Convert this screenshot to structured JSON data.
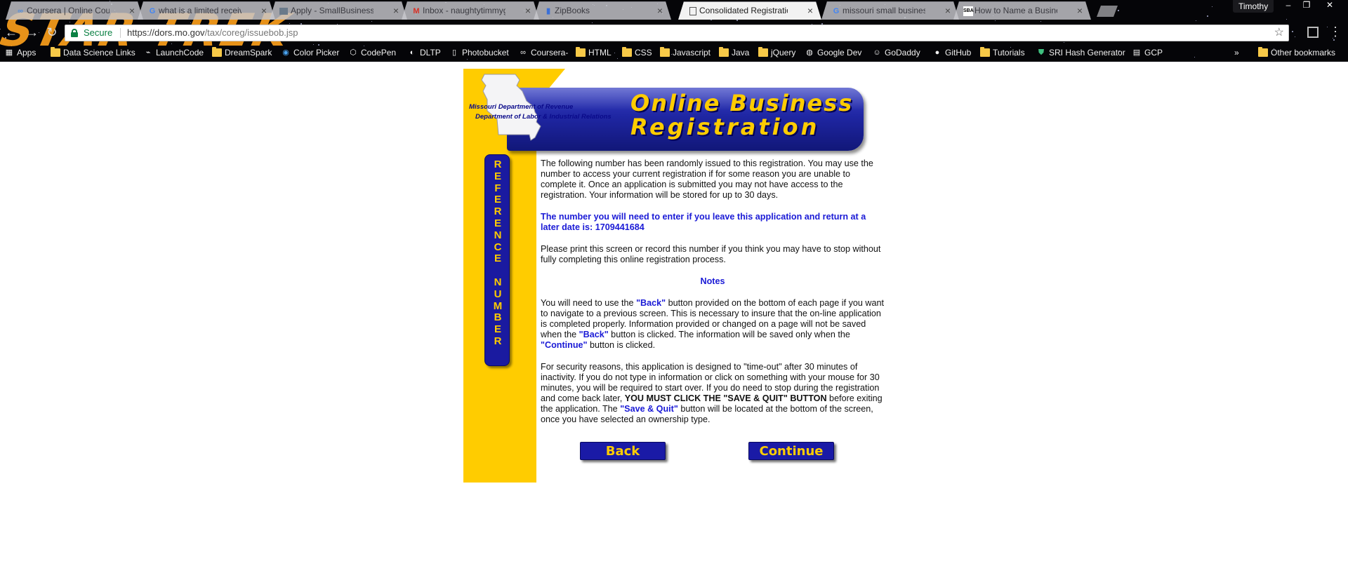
{
  "browser": {
    "tabs": [
      {
        "label": "Coursera | Online Cours",
        "icon": "coursera-icon",
        "active": false
      },
      {
        "label": "what is a limited receive",
        "icon": "google-icon",
        "active": false
      },
      {
        "label": "Apply - SmallBusinessBa",
        "icon": "page-icon",
        "active": false
      },
      {
        "label": "Inbox - naughtytimmyg",
        "icon": "gmail-icon",
        "active": false
      },
      {
        "label": "ZipBooks",
        "icon": "zipbooks-icon",
        "active": false
      },
      {
        "label": "Consolidated Registratio",
        "icon": "document-icon",
        "active": true
      },
      {
        "label": "missouri small business",
        "icon": "google-icon",
        "active": false
      },
      {
        "label": "How to Name a Business",
        "icon": "site-icon",
        "active": false
      }
    ],
    "profile_name": "Timothy",
    "address_bar": {
      "secure_label": "Secure",
      "url_host": "https://dors.mo.gov",
      "url_path": "/tax/coreg/issuebob.jsp"
    },
    "bookmarks": [
      {
        "label": "Apps",
        "icon": "apps-grid-icon"
      },
      {
        "label": "Data Science Links",
        "icon": "folder-icon"
      },
      {
        "label": "LaunchCode",
        "icon": "launchcode-icon"
      },
      {
        "label": "DreamSpark",
        "icon": "folder-icon"
      },
      {
        "label": "Color Picker",
        "icon": "color-picker-icon"
      },
      {
        "label": "CodePen",
        "icon": "codepen-icon"
      },
      {
        "label": "DLTP",
        "icon": "dltp-icon"
      },
      {
        "label": "Photobucket",
        "icon": "page-icon"
      },
      {
        "label": "Coursera-",
        "icon": "coursera-icon"
      },
      {
        "label": "HTML",
        "icon": "folder-icon"
      },
      {
        "label": "CSS",
        "icon": "folder-icon"
      },
      {
        "label": "Javascript",
        "icon": "folder-icon"
      },
      {
        "label": "Java",
        "icon": "folder-icon"
      },
      {
        "label": "jQuery",
        "icon": "folder-icon"
      },
      {
        "label": "Google Dev",
        "icon": "google-dev-icon"
      },
      {
        "label": "GoDaddy",
        "icon": "godaddy-icon"
      },
      {
        "label": "GitHub",
        "icon": "github-icon"
      },
      {
        "label": "Tutorials",
        "icon": "folder-icon"
      },
      {
        "label": "SRI Hash Generator",
        "icon": "shield-icon"
      },
      {
        "label": "GCP",
        "icon": "gcp-icon"
      }
    ],
    "overflow_label": "»",
    "other_bookmarks_label": "Other bookmarks"
  },
  "page": {
    "header": {
      "agency_line1": "Missouri Department of Revenue",
      "agency_line2": "Department of Labor & Industrial Relations",
      "title_line1": "Online Business",
      "title_line2": "Registration"
    },
    "sidebar_badge": {
      "letters": [
        "R",
        "E",
        "F",
        "E",
        "R",
        "E",
        "N",
        "C",
        "E",
        " ",
        "N",
        "U",
        "M",
        "B",
        "E",
        "R"
      ]
    },
    "intro_text": "The following number has been randomly issued to this registration. You may use the number to access your current registration if for some reason you are unable to complete it. Once an application is submitted you may not have access to the registration. Your information will be stored for up to 30 days.",
    "reference_prefix": "The number you will need to enter if you leave this application and return at a later date is: ",
    "reference_number": "1709441684",
    "print_text": "Please print this screen or record this number if you think you may have to stop without fully completing this online registration process.",
    "notes_title": "Notes",
    "notes_p1": {
      "t1": "You will need to use the ",
      "back_label": "\"Back\"",
      "t2": " button provided on the bottom of each page if you want to navigate to a previous screen. This is necessary to insure that the on-line application is completed properly. Information provided or changed on a page will not be saved when the ",
      "back_label2": "\"Back\"",
      "t3": " button is clicked. The information will be saved only when the ",
      "continue_label": "\"Continue\"",
      "t4": " button is clicked."
    },
    "notes_p2": {
      "t1": "For security reasons, this application is designed to \"time-out\" after 30 minutes of inactivity. If you do not type in information or click on something with your mouse for 30 minutes, you will be required to start over. If you do need to stop during the registration and come back later, ",
      "emphasis": "YOU MUST CLICK THE \"SAVE & QUIT\" BUTTON",
      "t2": " before exiting the application. The ",
      "save_quit_label": "\"Save & Quit\"",
      "t3": " button will be located at the bottom of the screen, once you have selected an ownership type."
    },
    "buttons": {
      "back": "Back",
      "continue": "Continue"
    }
  },
  "colors": {
    "accent_yellow": "#ffcc00",
    "banner_blue": "#1f26a3",
    "link_blue": "#1a1ad6",
    "secure_green": "#0b8043"
  }
}
